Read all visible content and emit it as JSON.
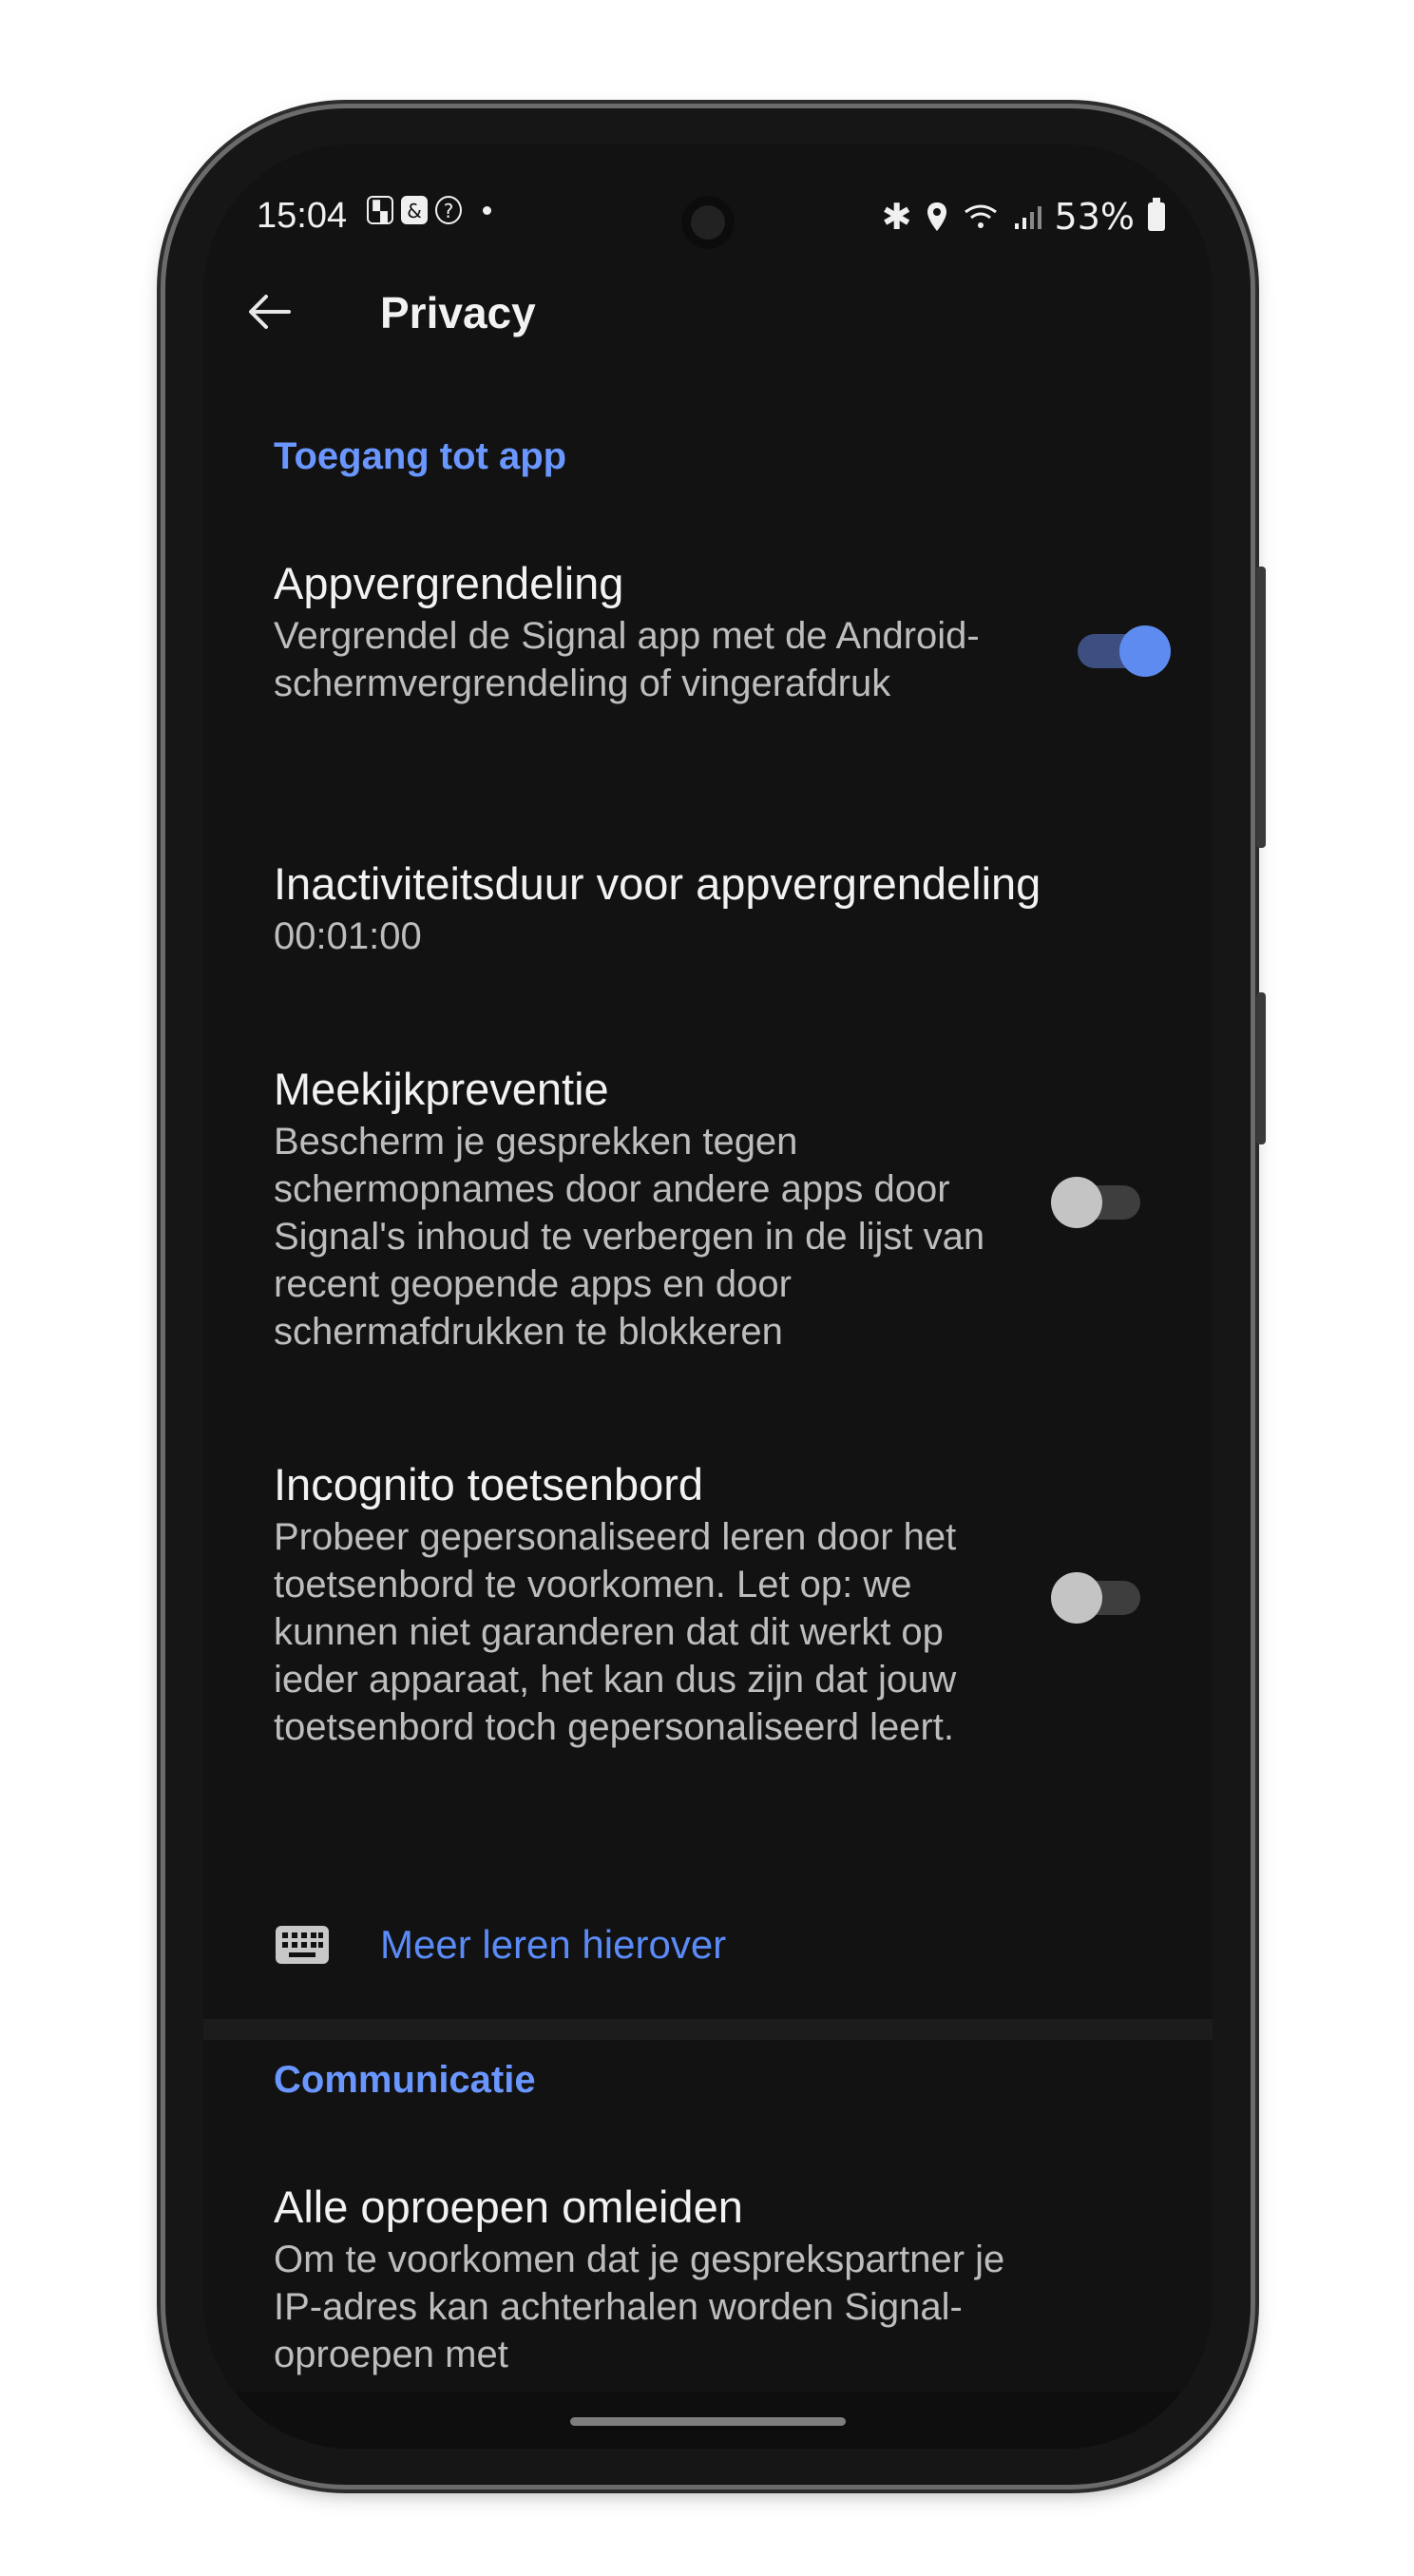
{
  "status_bar": {
    "time": "15:04",
    "left_icons": [
      "flipboard-icon",
      "ampersand-icon",
      "help-icon",
      "dot-icon"
    ],
    "battery": "53%"
  },
  "app_bar": {
    "title": "Privacy",
    "back_icon": "arrow-left-icon"
  },
  "sections": {
    "app_access": {
      "header": "Toegang tot app",
      "app_lock": {
        "title": "Appvergrendeling",
        "description": "Vergrendel de Signal app met de Android-schermvergrendeling of vingerafdruk",
        "enabled": true
      },
      "inactivity": {
        "title": "Inactiviteitsduur voor appvergrendeling",
        "value": "00:01:00"
      },
      "screen_security": {
        "title": "Meekijkpreventie",
        "description": "Bescherm je gesprekken tegen schermopnames door andere apps door Signal's inhoud te verbergen in de lijst van recent geopende apps en door schermafdrukken te blokkeren",
        "enabled": false
      },
      "incognito_keyboard": {
        "title": "Incognito toetsenbord",
        "description": "Probeer gepersonaliseerd leren door het toetsenbord te voorkomen. Let op: we kunnen niet garanderen dat dit werkt op ieder apparaat, het kan dus zijn dat jouw toetsenbord toch gepersonaliseerd leert.",
        "enabled": false
      },
      "learn_more": {
        "icon": "keyboard-icon",
        "label": "Meer leren hierover"
      }
    },
    "communication": {
      "header": "Communicatie",
      "relay_calls": {
        "title": "Alle oproepen omleiden",
        "description": "Om te voorkomen dat je gesprekspartner je IP-adres kan achterhalen worden Signal-oproepen met"
      }
    }
  },
  "colors": {
    "background": "#121212",
    "accent": "#5d8bf0",
    "section_header": "#6a96ff"
  }
}
